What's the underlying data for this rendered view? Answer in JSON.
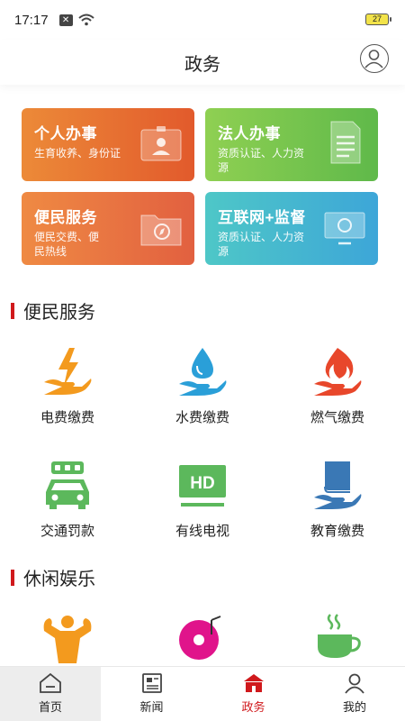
{
  "status_bar": {
    "time": "17:17",
    "battery": "27"
  },
  "header": {
    "title": "政务"
  },
  "cards": [
    {
      "title": "个人办事",
      "subtitle": "生育收养、身份证",
      "icon": "id-card-icon"
    },
    {
      "title": "法人办事",
      "subtitle": "资质认证、人力资源",
      "icon": "document-icon"
    },
    {
      "title": "便民服务",
      "subtitle": "便民交费、便民热线",
      "icon": "compass-folder-icon"
    },
    {
      "title": "互联网+监督",
      "subtitle": "资质认证、人力资源",
      "icon": "monitor-icon"
    }
  ],
  "sections": {
    "services": "便民服务",
    "leisure": "休闲娱乐"
  },
  "services": [
    {
      "label": "电费缴费",
      "icon": "electricity-icon"
    },
    {
      "label": "水费缴费",
      "icon": "water-drop-icon"
    },
    {
      "label": "燃气缴费",
      "icon": "gas-flame-icon"
    },
    {
      "label": "交通罚款",
      "icon": "car-icon"
    },
    {
      "label": "有线电视",
      "icon": "hd-tv-icon"
    },
    {
      "label": "教育缴费",
      "icon": "book-icon"
    }
  ],
  "leisure": [
    {
      "icon": "fitness-icon"
    },
    {
      "icon": "music-disc-icon"
    },
    {
      "icon": "tea-cup-icon"
    }
  ],
  "nav": [
    {
      "label": "首页",
      "icon": "home-icon"
    },
    {
      "label": "新闻",
      "icon": "news-icon"
    },
    {
      "label": "政务",
      "icon": "government-icon"
    },
    {
      "label": "我的",
      "icon": "profile-icon"
    }
  ],
  "colors": {
    "accent": "#d0191c",
    "orange_icon": "#f39a1e",
    "blue_icon": "#2a9fd8",
    "green_icon": "#5cb85c"
  }
}
